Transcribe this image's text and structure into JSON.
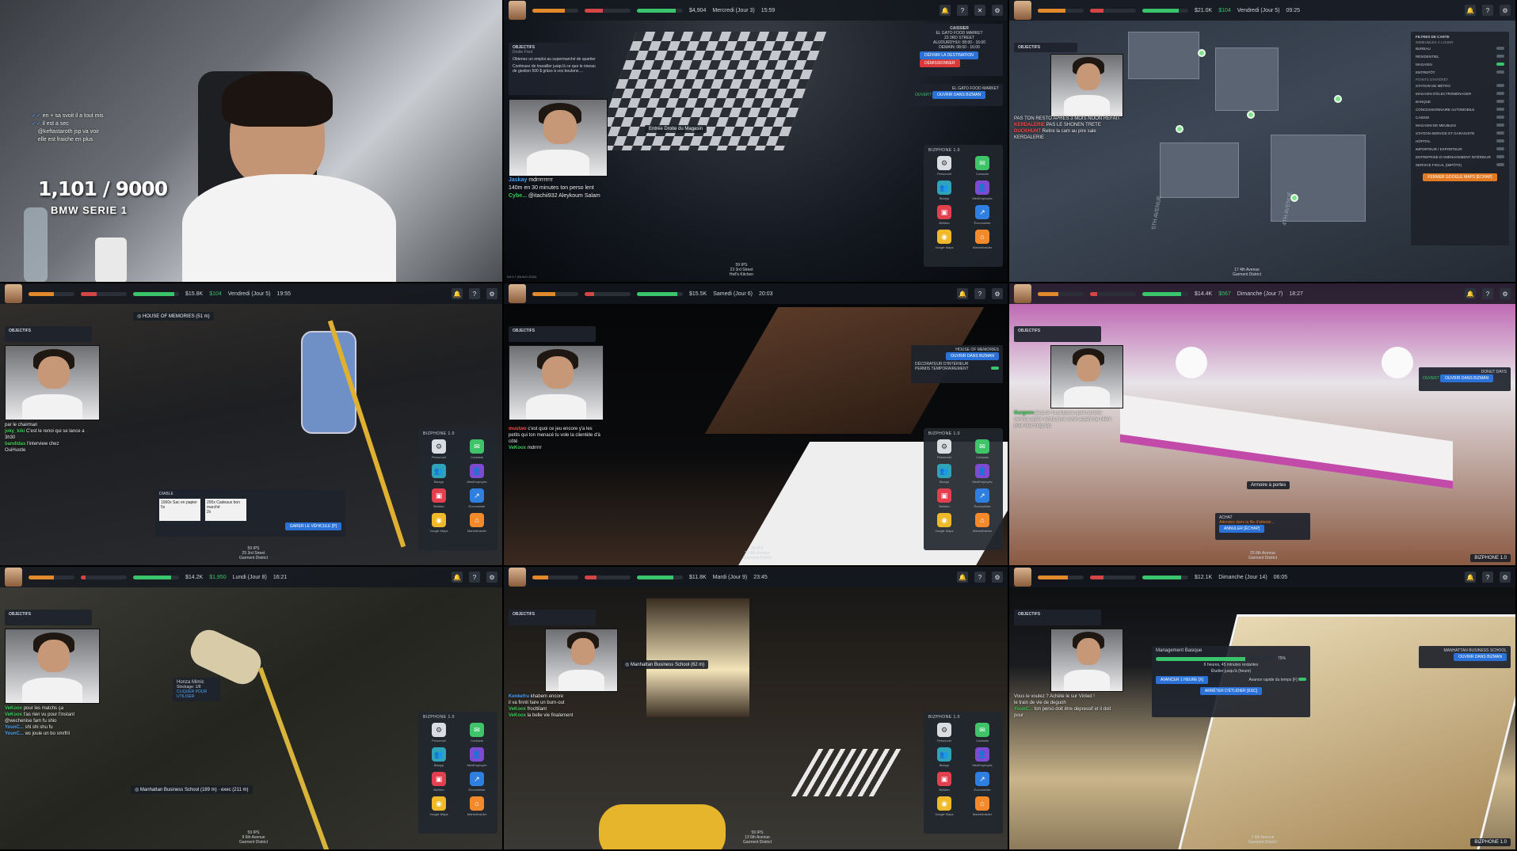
{
  "cell1": {
    "counter": "1,101 / 9000",
    "caption": "BMW SERIE 1",
    "chat": [
      {
        "user": "",
        "text": "en + sa svoit il a tout mis"
      },
      {
        "user": "",
        "text": "il est a sec"
      },
      {
        "user": "",
        "text": "@keftastaroth jsp va voir"
      },
      {
        "user": "",
        "text": "elle est fraiche en plus"
      }
    ]
  },
  "cell2": {
    "hud": {
      "money": "$4,904",
      "day": "Mercredi (Jour 3)",
      "time": "15:59"
    },
    "objectives_title": "OBJECTIFS",
    "objectives_sub": "Droite Fred",
    "objective_lines": [
      "Obtenez un emploi au supermarché de quartier",
      "Continuez de travailler jusqu'à ce que le niveau de gestion 500 $ grâce à vos boutons ..."
    ],
    "store_panel": {
      "title": "CAISSIER",
      "name": "EL GATO FOOD MARKET",
      "address": "23 3RD STREET",
      "today": "AUJOURD'HUI: 08:00 - 16:00",
      "tomorrow": "DEMAIN: 08:00 - 16:00",
      "btn1": "DÉFINIR LA DESTINATION",
      "btn2": "DÉMISSIONNER"
    },
    "store_panel2": {
      "title": "EL GATO FOOD MARKET",
      "status": "OUVERT",
      "btn": "OUVRIR DANS BIZMAN"
    },
    "entrance_label": "Entrée Droite du Magasin",
    "chat": [
      {
        "user": "Jaskay",
        "text": "mdrrrrrrrrr"
      },
      {
        "user": "",
        "text": "140m en 30 minutes ton perso lent"
      },
      {
        "user": "Cybe...",
        "text": "@itachii932 Aleykoum Salam"
      }
    ],
    "location": {
      "fps": "59 IPS",
      "street": "23 3rd Street",
      "district": "Hell's Kitchen"
    },
    "version": "EA 0.7 (BUILD 2002)"
  },
  "cell3": {
    "hud": {
      "money": "$21.0K",
      "extra": "$104",
      "day": "Vendredi (Jour 5)",
      "time": "09:25"
    },
    "objectives_title": "OBJECTIFS",
    "chat": [
      {
        "user": "",
        "text": "PAS TON RESTO APRES 3 MOIS NOON REFAIT"
      },
      {
        "user": "KERDALERIE",
        "text": "PAS LE SHONEN TRETE"
      },
      {
        "user": "DUCKHUNT",
        "text": "Retire la cam au pire sale"
      },
      {
        "user": "",
        "text": "KERDALERIE"
      }
    ],
    "filter_title": "FILTRES DE CARTE",
    "filter_section1": "IMMEUBLES À LOUER",
    "filters": [
      "BUREAU",
      "RÉSIDENTIEL",
      "MAGASIN",
      "ENTREPÔT"
    ],
    "filter_section2": "POINTS D'INTÉRÊT",
    "filters2": [
      "STATION DE MÉTRO",
      "MAGASIN D'ÉLECTROMÉNAGER",
      "BANQUE",
      "CONCESSIONNAIRE AUTOMOBILE",
      "CASINO",
      "MAGASIN DE MEUBLES",
      "STATION-SERVICE ET GARAGISTE",
      "HÔPITAL",
      "IMPORTEUR / EXPORTEUR",
      "ENTREPRISE D'AMÉNAGEMENT INTÉRIEUR",
      "SERVICE FISCAL (IMPÔTS)"
    ],
    "filter_btn": "FERMER GOOGLE MAPS [ÉCHAP]",
    "street_labels": [
      "5TH AVENUE",
      "4TH AVENUE"
    ],
    "location": {
      "street": "17 4th Avenue",
      "district": "Garment District"
    }
  },
  "cell4": {
    "hud": {
      "money": "$15.8K",
      "extra": "$104",
      "day": "Vendredi (Jour 5)",
      "time": "19:55"
    },
    "destination": "HOUSE OF MEMORIES (51 m)",
    "chat": [
      {
        "user": "",
        "text": "par le chairman"
      },
      {
        "user": "joky_kiki",
        "text": "C'est le renoi qui se lance a"
      },
      {
        "user": "",
        "text": "3h30"
      },
      {
        "user": "bandidas",
        "text": "l'interview chez"
      },
      {
        "user": "",
        "text": "OuiHustle"
      }
    ],
    "dialog": {
      "title": "DIABLE",
      "item1": "1000x Sac en papier",
      "item1_price": "5x",
      "item2": "200x Cadeaux bon marché",
      "item2_price": "2x",
      "btn": "GARER LE VÉHICULE [P]"
    },
    "phone_title": "BIZPHONE 1.0",
    "location": {
      "fps": "59 IPS",
      "street": "25 3rd Street",
      "district": "Garment District"
    }
  },
  "cell5": {
    "hud": {
      "money": "$15.5K",
      "day": "Samedi (Jour 6)",
      "time": "20:03"
    },
    "panel": {
      "title": "HOUSE OF MEMORIES",
      "btn": "OUVRIR DANS BIZMAN",
      "sub": "DÉCORATEUR D'INTÉRIEUR",
      "row": "PERMIS TEMPORAIREMENT"
    },
    "chat": [
      {
        "user": "mustwo",
        "text": "c'est quoi ce jeu encore y'a les petits qui ton menacé tu vole la clientèle d'à côté"
      },
      {
        "user": "VeKoox",
        "text": "mdrrrrr"
      }
    ],
    "phone_title": "BIZPHONE 1.0",
    "location": {
      "fps": "59 IPS",
      "street": "21 4th Avenue",
      "district": "Garment District"
    }
  },
  "cell6": {
    "hud": {
      "money": "$14.4K",
      "extra": "$567",
      "day": "Dimanche (Jour 7)",
      "time": "18:27"
    },
    "shop_panel": {
      "title": "DONUT DAYS",
      "status": "OUVERT",
      "btn": "OUVRIR DANS BIZMAN"
    },
    "chat": [
      {
        "user": "Gurgeon",
        "text": "jai jurer tu propose quel comme service après vente pour avoir autant de client pour des mug stp"
      }
    ],
    "object_label": "Armoire à portes",
    "buy_panel": {
      "title": "ACHAT",
      "hint": "Attendez dans la file d'attente...",
      "btn": "ANNULER [ÉCHAP]"
    },
    "phone_title": "BIZPHONE 1.0",
    "location": {
      "street": "25 6th Avenue",
      "district": "Garment District"
    }
  },
  "cell7": {
    "hud": {
      "money": "$14.2K",
      "extra": "$1,950",
      "day": "Lundi (Jour 8)",
      "time": "16:21"
    },
    "vehicle": {
      "name": "Honza Mimic",
      "storage": "Stockage: 1/8",
      "hint": "CLIQUER POUR UTILISER"
    },
    "destination": "Manhattan Business School (189 m) · exec (211 m)",
    "chat": [
      {
        "user": "VeKoox",
        "text": "pour les matchs ça"
      },
      {
        "user": "VeKoox",
        "text": "t'as rien vu pour l'instant"
      },
      {
        "user": "",
        "text": "@wechenise fam fu shio"
      },
      {
        "user": "YounC...",
        "text": "shi shi shu fu"
      },
      {
        "user": "YounC...",
        "text": "ws jouie un bo smrfril"
      }
    ],
    "phone_title": "BIZPHONE 1.0",
    "location": {
      "fps": "59 IPS",
      "street": "9 6th Avenue",
      "district": "Garment District"
    }
  },
  "cell8": {
    "hud": {
      "money": "$11.8K",
      "day": "Mardi (Jour 9)",
      "time": "23:45"
    },
    "destination": "Manhattan Business School (62 m)",
    "chat": [
      {
        "user": "Kenkefru",
        "text": "khabem encore"
      },
      {
        "user": "",
        "text": "il va finnit faire un burn-out"
      },
      {
        "user": "VeKoox",
        "text": "frocttilant"
      },
      {
        "user": "VeKoox",
        "text": "la belle vie finalement"
      }
    ],
    "phone_title": "BIZPHONE 1.0",
    "location": {
      "fps": "59 IPS",
      "street": "13 6th Avenue",
      "district": "Garment District"
    }
  },
  "cell9": {
    "hud": {
      "money": "$12.1K",
      "day": "Dimanche (Jour 14)",
      "time": "06:05"
    },
    "school_panel": {
      "title": "MANHATTAN BUSINESS SCHOOL",
      "btn": "OUVRIR DANS BIZMAN"
    },
    "study": {
      "title": "Management Basique",
      "percent": "75%",
      "remaining": "6 heures, 45 minutes restantes",
      "until": "Étudier jusqu'à (heure)",
      "btn1": "AVANCER 1 HEURE [X]",
      "btn2": "Avance rapide du temps [F]",
      "btn3": "ARRÊTER D'ÉTUDIER [ESC]"
    },
    "chat": [
      {
        "user": "",
        "text": "Vous le voulez ? Achète le sur Vinted !"
      },
      {
        "user": "",
        "text": "le train de vie de deguoh"
      },
      {
        "user": "YounC...",
        "text": "ton perso doit être dépressif et il doit pour"
      }
    ],
    "phone_title": "BIZPHONE 1.0",
    "location": {
      "street": "1 6th Avenue",
      "district": "Garment District"
    }
  },
  "phone_apps": [
    {
      "label": "Personnel",
      "color": "#d9dde2",
      "icon": "gear-icon"
    },
    {
      "label": "Contacts",
      "color": "#3fc46a",
      "icon": "chat-icon"
    },
    {
      "label": "Bizapp",
      "color": "#2fa3b9",
      "icon": "people-icon"
    },
    {
      "label": "MesEmployés",
      "color": "#7c4bd1",
      "icon": "user-icon"
    },
    {
      "label": "BizMan",
      "color": "#e2404e",
      "icon": "briefcase-icon"
    },
    {
      "label": "Économiste",
      "color": "#2f7fe0",
      "icon": "chart-icon"
    },
    {
      "label": "Voogle Maps",
      "color": "#f0b92a",
      "icon": "map-icon"
    },
    {
      "label": "MarketInsider",
      "color": "#f28a2c",
      "icon": "market-icon"
    }
  ]
}
